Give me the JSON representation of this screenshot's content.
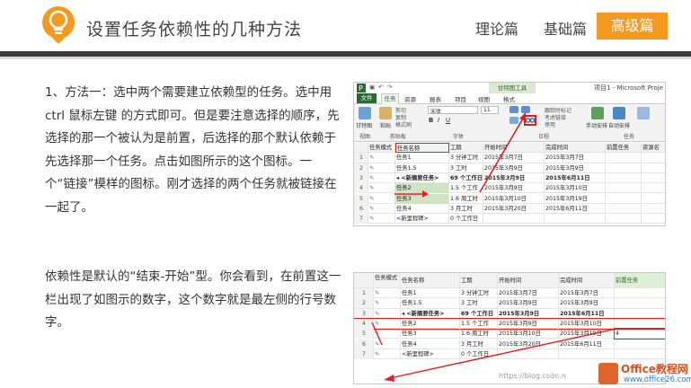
{
  "header": {
    "title": "设置任务依赖性的几种方法",
    "tabs": [
      {
        "label": "理论篇",
        "active": false
      },
      {
        "label": "基础篇",
        "active": false
      },
      {
        "label": "高级篇",
        "active": true
      }
    ],
    "accent_color": "#f49a1e"
  },
  "content": {
    "paragraph1": "1、方法一：选中两个需要建立依赖型的任务。选中用 ctrl 鼠标左键 的方式即可。但是要注意选择的顺序，先选择的那一个被认为是前置，后选择的那个默认依赖于先选择那一个任务。点击如图所示的这个图标。一个“链接”模样的图标。刚才选择的两个任务就被链接在一起了。",
    "paragraph2": "依赖性是默认的“结束-开始”型。你会看到，在前置这一栏出现了如图示的数字，这个数字就是最左侧的行号数字。"
  },
  "screenshot1": {
    "app_title": "项目1 - Microsoft Proje",
    "context_header": "甘特图工具",
    "ribbon_tabs": {
      "file": "文件",
      "task": "任务",
      "resource": "资源",
      "report": "报表",
      "project": "项目",
      "view": "视图",
      "format": "格式"
    },
    "ribbon_groups": {
      "view": "视图",
      "clipboard": "剪贴板",
      "font": "字体",
      "schedule": "日程",
      "tasks": "任务"
    },
    "ribbon_labels": {
      "gantt": "甘特图",
      "paste": "粘贴",
      "cut": "剪切",
      "copy": "复制",
      "format_painter": "格式刷",
      "font_name": "宋体",
      "font_size": "11",
      "mark_on_track": "跟踪时标记",
      "respect_links": "考虑链接",
      "inactivate": "停用",
      "manual_schedule": "手动安排",
      "auto_schedule": "自动安排"
    },
    "columns": [
      "任务模式",
      "任务名称",
      "工期",
      "开始时间",
      "完成时间",
      "前置任务",
      "资源名"
    ],
    "rows": [
      {
        "id": "1",
        "name": "任务1",
        "duration": "3 分钟工时",
        "start": "2015年3月7日",
        "finish": "2015年3月7日",
        "pred": ""
      },
      {
        "id": "2",
        "name": "任务1.5",
        "duration": "3 工时",
        "start": "2015年3月9日",
        "finish": "2015年3月9日",
        "pred": ""
      },
      {
        "id": "3",
        "name": "◂ <新摘要任务>",
        "duration": "69 个工作日",
        "start": "2015年3月9日",
        "finish": "2015年6月11日",
        "pred": ""
      },
      {
        "id": "4",
        "name": "任务2",
        "duration": "1.5 个工作",
        "start": "2015年3月9日",
        "finish": "2015年3月10日",
        "pred": ""
      },
      {
        "id": "5",
        "name": "任务3",
        "duration": "1.6 周工时",
        "start": "2015年3月10日",
        "finish": "2015年3月19日",
        "pred": ""
      },
      {
        "id": "6",
        "name": "任务4",
        "duration": "3 月工时",
        "start": "2015年3月20日",
        "finish": "2015年6月11日",
        "pred": ""
      },
      {
        "id": "7",
        "name": "<新里程碑>",
        "duration": "0 个工作日",
        "start": "",
        "finish": "",
        "pred": ""
      }
    ]
  },
  "screenshot2": {
    "columns": [
      "任务模式",
      "任务名称",
      "工期",
      "开始时间",
      "完成时间",
      "前置任务"
    ],
    "rows": [
      {
        "id": "1",
        "name": "任务1",
        "duration": "3 分钟工时",
        "start": "2015年3月7日",
        "finish": "2015年3月7日",
        "pred": ""
      },
      {
        "id": "2",
        "name": "任务1.5",
        "duration": "3 工时",
        "start": "2015年3月9日",
        "finish": "2015年3月9日",
        "pred": ""
      },
      {
        "id": "3",
        "name": "◂ <新摘要任务>",
        "duration": "69 个工作日",
        "start": "2015年3月9日",
        "finish": "2015年6月11日",
        "pred": ""
      },
      {
        "id": "4",
        "name": "任务2",
        "duration": "1.5 个工作",
        "start": "2015年3月9日",
        "finish": "2015年3月10日",
        "pred": ""
      },
      {
        "id": "5",
        "name": "任务3",
        "duration": "1.6 周工时",
        "start": "2015年3月10日",
        "finish": "2015年3月19日",
        "pred": "4"
      },
      {
        "id": "6",
        "name": "任务4",
        "duration": "3 月工时",
        "start": "2015年3月20日",
        "finish": "2015年6月11日",
        "pred": ""
      },
      {
        "id": "7",
        "name": "<新里程碑>",
        "duration": "0 个工作日",
        "start": "",
        "finish": "",
        "pred": ""
      }
    ]
  },
  "watermark": {
    "url": "https://blog.csdn.n",
    "brand_name": "Office教程网",
    "brand_site": "www.office26.com"
  }
}
